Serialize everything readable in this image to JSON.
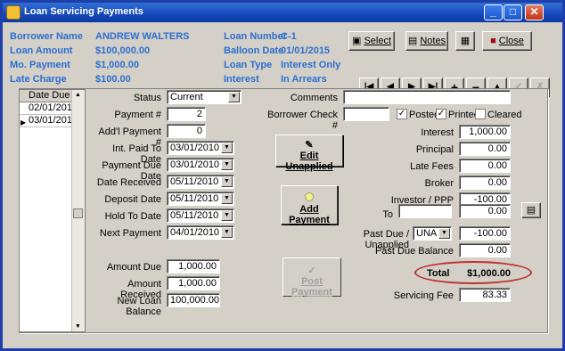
{
  "window": {
    "title": "Loan Servicing Payments"
  },
  "header": {
    "borrower_name_label": "Borrower Name",
    "borrower_name": "ANDREW WALTERS",
    "loan_amount_label": "Loan Amount",
    "loan_amount": "$100,000.00",
    "mo_payment_label": "Mo. Payment",
    "mo_payment": "$1,000.00",
    "late_charge_label": "Late Charge",
    "late_charge": "$100.00",
    "loan_number_label": "Loan Number",
    "loan_number": "C-1",
    "balloon_date_label": "Balloon Date",
    "balloon_date": "01/01/2015",
    "loan_type_label": "Loan Type",
    "loan_type": "Interest Only",
    "interest_label": "Interest",
    "interest": "In Arrears"
  },
  "toolbar": {
    "select": "Select",
    "notes": "Notes",
    "close": "Close"
  },
  "list": {
    "header": "Date Due",
    "rows": [
      "02/01/2010",
      "03/01/2010"
    ]
  },
  "left": {
    "status_label": "Status",
    "status": "Current",
    "payment_num_label": "Payment #",
    "payment_num": "2",
    "addl_payment_label": "Add'l Payment #",
    "addl_payment": "0",
    "int_paid_label": "Int. Paid To Date",
    "int_paid": "03/01/2010",
    "payment_due_label": "Payment Due Date",
    "payment_due": "03/01/2010",
    "date_received_label": "Date Received",
    "date_received": "05/11/2010",
    "deposit_date_label": "Deposit Date",
    "deposit_date": "05/11/2010",
    "hold_to_date_label": "Hold To Date",
    "hold_to_date": "05/11/2010",
    "next_payment_label": "Next Payment",
    "next_payment": "04/01/2010",
    "amount_due_label": "Amount Due",
    "amount_due": "1,000.00",
    "amount_received_label": "Amount Received",
    "amount_received": "1,000.00",
    "new_loan_balance_label": "New Loan Balance",
    "new_loan_balance": "100,000.00"
  },
  "buttons": {
    "edit_unapplied": "Edit Unapplied",
    "add_payment": "Add Payment",
    "post_payment": "Post Payment"
  },
  "right": {
    "comments_label": "Comments",
    "comments": "",
    "borrower_check_label": "Borrower Check #",
    "borrower_check": "",
    "posted_label": "Posted",
    "printed_label": "Printed",
    "cleared_label": "Cleared",
    "interest_label": "Interest",
    "interest": "1,000.00",
    "principal_label": "Principal",
    "principal": "0.00",
    "late_fees_label": "Late Fees",
    "late_fees": "0.00",
    "broker_label": "Broker",
    "broker": "0.00",
    "investor_label": "Investor / PPP",
    "investor": "-100.00",
    "to_label": "To",
    "to_name": "",
    "to_amount": "0.00",
    "past_due_label": "Past Due / Unapplied",
    "past_due_type": "UNA",
    "past_due": "-100.00",
    "past_due_balance_label": "Past Due Balance",
    "past_due_balance": "0.00",
    "total_label": "Total",
    "total": "$1,000.00",
    "servicing_fee_label": "Servicing Fee",
    "servicing_fee": "83.33"
  }
}
